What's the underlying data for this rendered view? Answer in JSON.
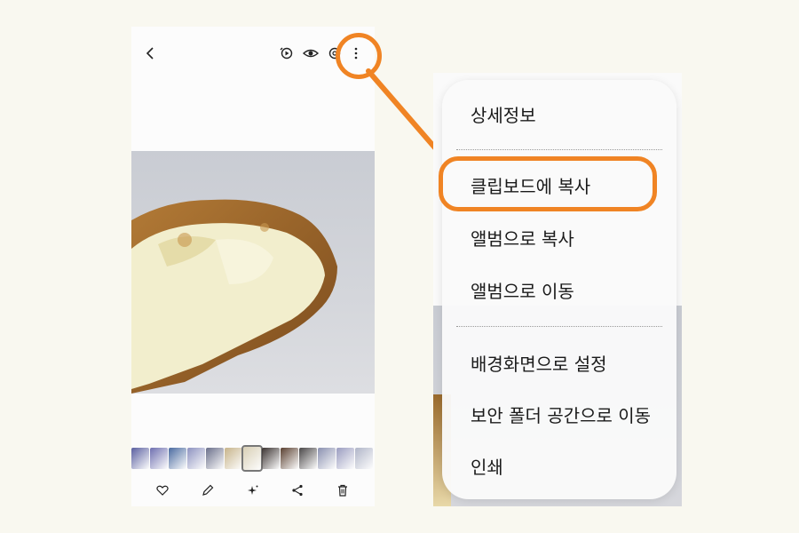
{
  "viewer": {
    "toolbar_icons": [
      "back-icon",
      "remaster-icon",
      "eye-icon",
      "lens-icon",
      "more-icon"
    ],
    "bottom_icons": [
      "heart-icon",
      "pencil-icon",
      "sparkle-icon",
      "share-icon",
      "trash-icon"
    ],
    "thumbnails": [
      "#5a5fa0",
      "#6e6fb0",
      "#4a6aa0",
      "#8d92c0",
      "#6a6f8a",
      "#c7b48a",
      "#d8cfb5",
      "#3a3230",
      "#5a4030",
      "#4a4748",
      "#8a90b0",
      "#9a9cc0",
      "#b0b5c8"
    ]
  },
  "menu": {
    "items": [
      "상세정보",
      "클립보드에 복사",
      "앨범으로 복사",
      "앨범으로 이동",
      "배경화면으로 설정",
      "보안 폴더 공간으로 이동",
      "인쇄"
    ]
  },
  "colors": {
    "highlight": "#f08424",
    "background": "#f9f8f0"
  }
}
